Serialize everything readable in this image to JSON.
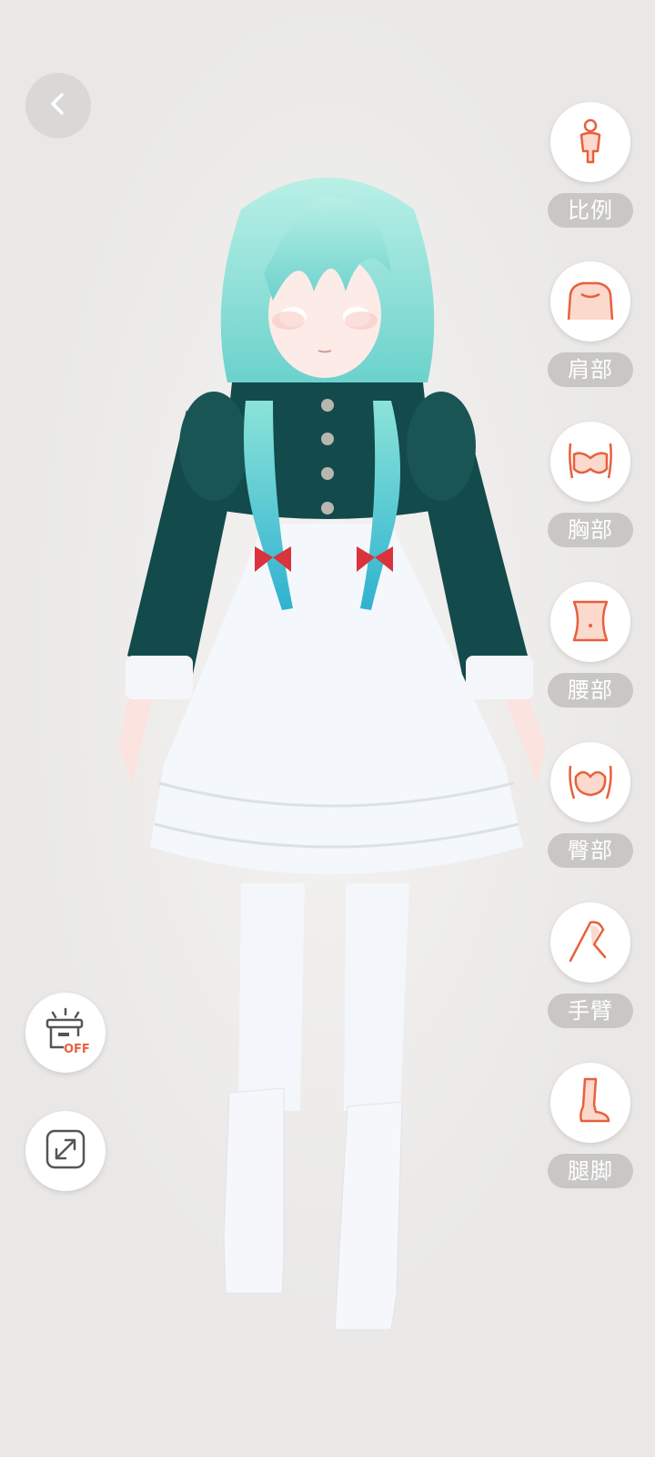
{
  "colors": {
    "background": "#e9e8e6",
    "accent": "#e8603c",
    "label_bg": "#c8c7c5"
  },
  "back_button": {
    "icon": "chevron-left-icon"
  },
  "body_parts": [
    {
      "label": "比例",
      "icon": "body-proportion-icon"
    },
    {
      "label": "肩部",
      "icon": "shoulder-icon"
    },
    {
      "label": "胸部",
      "icon": "chest-icon"
    },
    {
      "label": "腰部",
      "icon": "waist-icon"
    },
    {
      "label": "臀部",
      "icon": "hip-icon"
    },
    {
      "label": "手臂",
      "icon": "arm-icon"
    },
    {
      "label": "腿脚",
      "icon": "leg-foot-icon"
    }
  ],
  "tools": {
    "light_toggle": {
      "icon": "lamp-off-icon",
      "badge": "OFF"
    },
    "fullscreen": {
      "icon": "expand-icon"
    }
  }
}
